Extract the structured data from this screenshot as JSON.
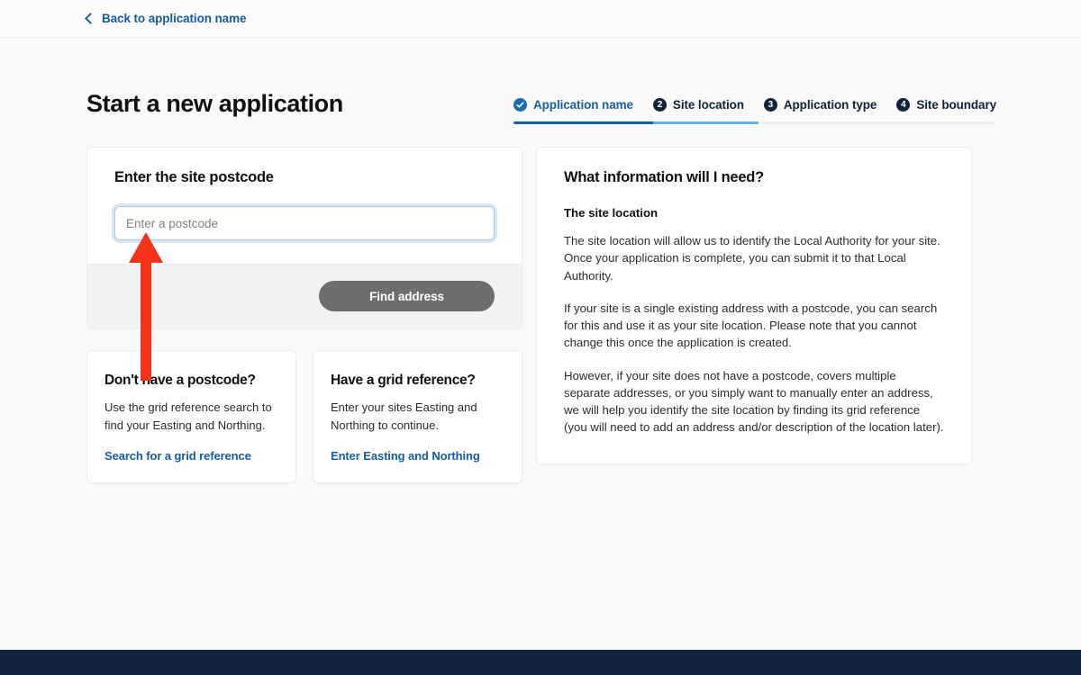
{
  "topbar": {
    "back_label": "Back to application name",
    "back_icon": "chevron-left-icon"
  },
  "header": {
    "title": "Start a new application"
  },
  "steps": [
    {
      "label": "Application name",
      "badge": "✓",
      "state": "complete"
    },
    {
      "label": "Site location",
      "badge": "2",
      "state": "current"
    },
    {
      "label": "Application type",
      "badge": "3",
      "state": "upcoming"
    },
    {
      "label": "Site boundary",
      "badge": "4",
      "state": "upcoming"
    }
  ],
  "progress": {
    "segments": [
      {
        "name": "complete",
        "color": "#1461a0",
        "width_pct": 29
      },
      {
        "name": "current",
        "color": "#5eb3e8",
        "width_pct": 22
      },
      {
        "name": "remaining",
        "color": "#efefef",
        "width_pct": 49
      }
    ]
  },
  "form": {
    "title": "Enter the site postcode",
    "postcode_value": "",
    "postcode_placeholder": "Enter a postcode",
    "find_button_label": "Find address"
  },
  "options": [
    {
      "title": "Don't have a postcode?",
      "text": "Use the grid reference search to find your Easting and Northing.",
      "link": "Search for a grid reference"
    },
    {
      "title": "Have a grid reference?",
      "text": "Enter your sites Easting and Northing to continue.",
      "link": "Enter Easting and Northing"
    }
  ],
  "info": {
    "title": "What information will I need?",
    "subtitle": "The site location",
    "paragraphs": [
      "The site location will allow us to identify the Local Authority for your site. Once your application is complete, you can submit it to that Local Authority.",
      "If your site is a single existing address with a postcode, you can search for this and use it as your site location. Please note that you cannot change this once the application is created.",
      "However, if your site does not have a postcode, covers multiple separate addresses, or you simply want to manually enter an address, we will help you identify the site location by finding its grid reference (you will need to add an address and/or description of the location later)."
    ]
  },
  "annotation": {
    "arrow_color": "#f4331a",
    "points_to": "postcode-input"
  },
  "colors": {
    "accent_blue": "#1a5f9e",
    "navy": "#11243c",
    "page_bg": "#fafafa",
    "disabled_button": "#6e6e6e"
  }
}
